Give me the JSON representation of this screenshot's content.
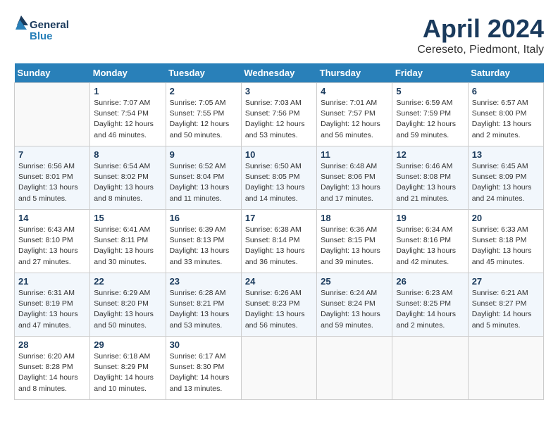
{
  "header": {
    "logo_line1": "General",
    "logo_line2": "Blue",
    "month_title": "April 2024",
    "location": "Cereseto, Piedmont, Italy"
  },
  "days_of_week": [
    "Sunday",
    "Monday",
    "Tuesday",
    "Wednesday",
    "Thursday",
    "Friday",
    "Saturday"
  ],
  "weeks": [
    [
      {
        "day": "",
        "info": ""
      },
      {
        "day": "1",
        "info": "Sunrise: 7:07 AM\nSunset: 7:54 PM\nDaylight: 12 hours\nand 46 minutes."
      },
      {
        "day": "2",
        "info": "Sunrise: 7:05 AM\nSunset: 7:55 PM\nDaylight: 12 hours\nand 50 minutes."
      },
      {
        "day": "3",
        "info": "Sunrise: 7:03 AM\nSunset: 7:56 PM\nDaylight: 12 hours\nand 53 minutes."
      },
      {
        "day": "4",
        "info": "Sunrise: 7:01 AM\nSunset: 7:57 PM\nDaylight: 12 hours\nand 56 minutes."
      },
      {
        "day": "5",
        "info": "Sunrise: 6:59 AM\nSunset: 7:59 PM\nDaylight: 12 hours\nand 59 minutes."
      },
      {
        "day": "6",
        "info": "Sunrise: 6:57 AM\nSunset: 8:00 PM\nDaylight: 13 hours\nand 2 minutes."
      }
    ],
    [
      {
        "day": "7",
        "info": "Sunrise: 6:56 AM\nSunset: 8:01 PM\nDaylight: 13 hours\nand 5 minutes."
      },
      {
        "day": "8",
        "info": "Sunrise: 6:54 AM\nSunset: 8:02 PM\nDaylight: 13 hours\nand 8 minutes."
      },
      {
        "day": "9",
        "info": "Sunrise: 6:52 AM\nSunset: 8:04 PM\nDaylight: 13 hours\nand 11 minutes."
      },
      {
        "day": "10",
        "info": "Sunrise: 6:50 AM\nSunset: 8:05 PM\nDaylight: 13 hours\nand 14 minutes."
      },
      {
        "day": "11",
        "info": "Sunrise: 6:48 AM\nSunset: 8:06 PM\nDaylight: 13 hours\nand 17 minutes."
      },
      {
        "day": "12",
        "info": "Sunrise: 6:46 AM\nSunset: 8:08 PM\nDaylight: 13 hours\nand 21 minutes."
      },
      {
        "day": "13",
        "info": "Sunrise: 6:45 AM\nSunset: 8:09 PM\nDaylight: 13 hours\nand 24 minutes."
      }
    ],
    [
      {
        "day": "14",
        "info": "Sunrise: 6:43 AM\nSunset: 8:10 PM\nDaylight: 13 hours\nand 27 minutes."
      },
      {
        "day": "15",
        "info": "Sunrise: 6:41 AM\nSunset: 8:11 PM\nDaylight: 13 hours\nand 30 minutes."
      },
      {
        "day": "16",
        "info": "Sunrise: 6:39 AM\nSunset: 8:13 PM\nDaylight: 13 hours\nand 33 minutes."
      },
      {
        "day": "17",
        "info": "Sunrise: 6:38 AM\nSunset: 8:14 PM\nDaylight: 13 hours\nand 36 minutes."
      },
      {
        "day": "18",
        "info": "Sunrise: 6:36 AM\nSunset: 8:15 PM\nDaylight: 13 hours\nand 39 minutes."
      },
      {
        "day": "19",
        "info": "Sunrise: 6:34 AM\nSunset: 8:16 PM\nDaylight: 13 hours\nand 42 minutes."
      },
      {
        "day": "20",
        "info": "Sunrise: 6:33 AM\nSunset: 8:18 PM\nDaylight: 13 hours\nand 45 minutes."
      }
    ],
    [
      {
        "day": "21",
        "info": "Sunrise: 6:31 AM\nSunset: 8:19 PM\nDaylight: 13 hours\nand 47 minutes."
      },
      {
        "day": "22",
        "info": "Sunrise: 6:29 AM\nSunset: 8:20 PM\nDaylight: 13 hours\nand 50 minutes."
      },
      {
        "day": "23",
        "info": "Sunrise: 6:28 AM\nSunset: 8:21 PM\nDaylight: 13 hours\nand 53 minutes."
      },
      {
        "day": "24",
        "info": "Sunrise: 6:26 AM\nSunset: 8:23 PM\nDaylight: 13 hours\nand 56 minutes."
      },
      {
        "day": "25",
        "info": "Sunrise: 6:24 AM\nSunset: 8:24 PM\nDaylight: 13 hours\nand 59 minutes."
      },
      {
        "day": "26",
        "info": "Sunrise: 6:23 AM\nSunset: 8:25 PM\nDaylight: 14 hours\nand 2 minutes."
      },
      {
        "day": "27",
        "info": "Sunrise: 6:21 AM\nSunset: 8:27 PM\nDaylight: 14 hours\nand 5 minutes."
      }
    ],
    [
      {
        "day": "28",
        "info": "Sunrise: 6:20 AM\nSunset: 8:28 PM\nDaylight: 14 hours\nand 8 minutes."
      },
      {
        "day": "29",
        "info": "Sunrise: 6:18 AM\nSunset: 8:29 PM\nDaylight: 14 hours\nand 10 minutes."
      },
      {
        "day": "30",
        "info": "Sunrise: 6:17 AM\nSunset: 8:30 PM\nDaylight: 14 hours\nand 13 minutes."
      },
      {
        "day": "",
        "info": ""
      },
      {
        "day": "",
        "info": ""
      },
      {
        "day": "",
        "info": ""
      },
      {
        "day": "",
        "info": ""
      }
    ]
  ]
}
